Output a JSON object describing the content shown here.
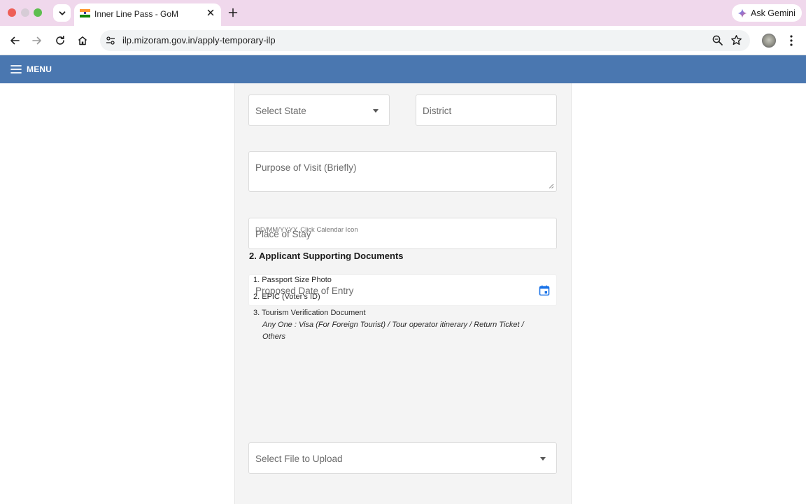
{
  "browser": {
    "tab_title": "Inner Line Pass - GoM",
    "url": "ilp.mizoram.gov.in/apply-temporary-ilp",
    "gemini_label": "Ask Gemini"
  },
  "header": {
    "menu_label": "MENU",
    "background_color": "#4a77b0"
  },
  "form": {
    "state_placeholder": "Select State",
    "district_placeholder": "District",
    "purpose_placeholder": "Purpose of Visit (Briefly)",
    "stay_placeholder": "Place of Stay",
    "entry_date_placeholder": "Proposed Date of Entry",
    "entry_date_helper": "DD/MM/YYYY. Click Calendar Icon",
    "calendar_icon_color": "#1a73e8"
  },
  "documents": {
    "title": "2. Applicant Supporting Documents",
    "items": [
      {
        "number": "1.",
        "label": "Passport Size Photo"
      },
      {
        "number": "2.",
        "label": "EPIC (Voter's ID)"
      },
      {
        "number": "3.",
        "label": "Tourism Verification Document"
      }
    ],
    "note_line1": "Any One : Visa (For Foreign Tourist) / Tour operator itinerary / Return Ticket /",
    "note_line2": "Others",
    "upload_placeholder": "Select File to Upload"
  }
}
